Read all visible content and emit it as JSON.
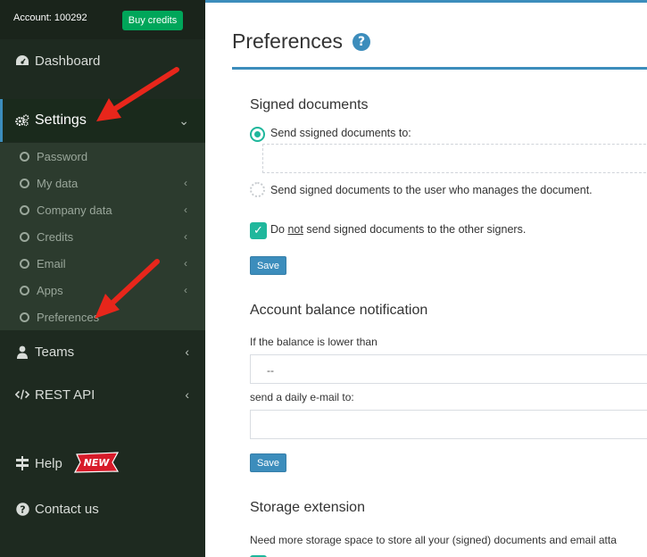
{
  "sidebar": {
    "account_label": "Account: 100292",
    "buy_credits_label": "Buy credits",
    "nav": {
      "dashboard": "Dashboard",
      "settings": "Settings",
      "teams": "Teams",
      "rest_api": "REST API",
      "help": "Help",
      "contact_us": "Contact us"
    },
    "new_badge": "NEW",
    "settings_sub": [
      {
        "label": "Password"
      },
      {
        "label": "My data"
      },
      {
        "label": "Company data"
      },
      {
        "label": "Credits"
      },
      {
        "label": "Email"
      },
      {
        "label": "Apps"
      },
      {
        "label": "Preferences"
      }
    ]
  },
  "main": {
    "page_title": "Preferences",
    "help_icon": "?",
    "signed_documents": {
      "title": "Signed documents",
      "radio1_label": "Send ssigned documents to:",
      "radio2_label": "Send signed documents to the user who manages the document.",
      "checkbox_pre": "Do ",
      "checkbox_not": "not",
      "checkbox_post": " send signed documents to the other signers.",
      "save_label": "Save"
    },
    "balance": {
      "title": "Account balance notification",
      "threshold_label": "If the balance is lower than",
      "threshold_value": "--",
      "email_label": "send a daily e-mail to:",
      "save_label": "Save"
    },
    "storage": {
      "title": "Storage extension",
      "description": "Need more storage space to store all your (signed) documents and email atta"
    }
  },
  "colors": {
    "sidebar_bg": "#1e2a20",
    "accent_blue": "#3c8dbc",
    "green_button": "#00a65a",
    "teal_check": "#1fb79c",
    "annotation_arrow": "#e8261b"
  }
}
